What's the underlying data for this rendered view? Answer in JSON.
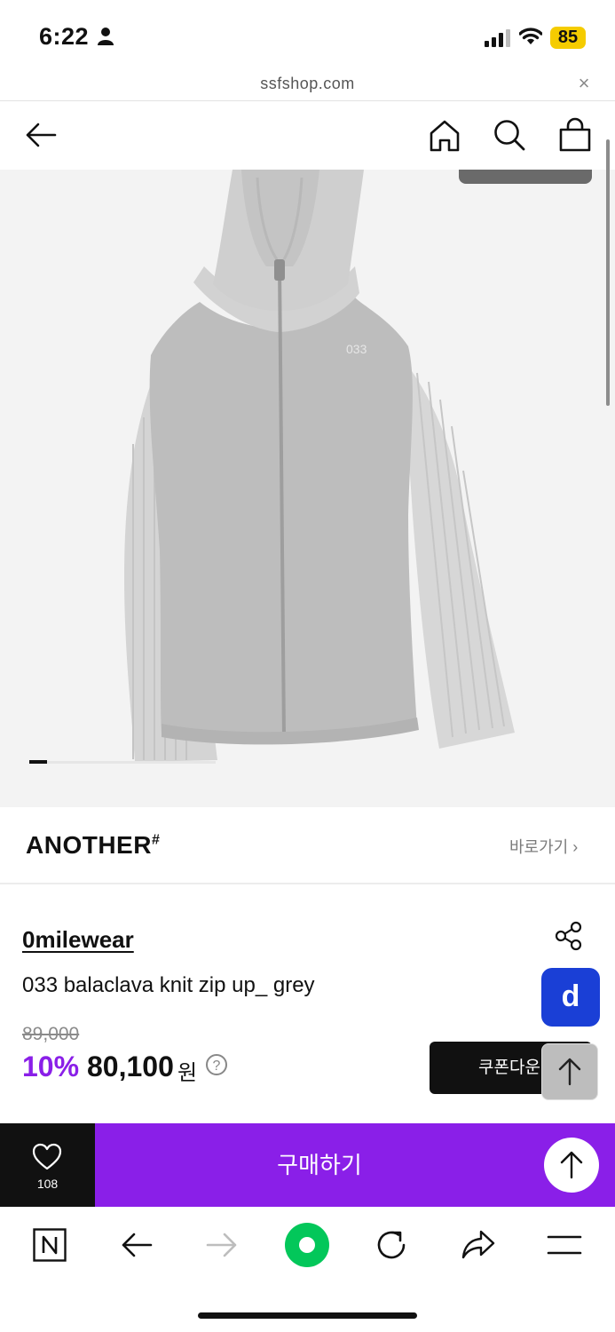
{
  "status_bar": {
    "time": "6:22",
    "battery": "85",
    "icons": [
      "person-icon",
      "signal-icon",
      "wifi-icon",
      "battery-icon"
    ]
  },
  "browser": {
    "url": "ssfshop.com",
    "close_glyph": "×"
  },
  "nav": {
    "icons": [
      "back-arrow-icon",
      "home-icon",
      "search-icon",
      "shopping-bag-icon"
    ]
  },
  "hero": {
    "embroidery": "033",
    "image_name": "grey-knit-zip-up-product-photo"
  },
  "brand": {
    "logo": "ANOTHER",
    "logo_mark": "#",
    "link_label": "바로가기 ›"
  },
  "product": {
    "seller": "0milewear",
    "name": "033 balaclava knit zip up_ grey",
    "original_price": "89,000",
    "discount": "10%",
    "price": "80,100",
    "currency": "원",
    "help": "?",
    "coupon_label": "쿠폰다운"
  },
  "floating": {
    "d_badge": "d",
    "icons": [
      "share-icon",
      "scroll-top-icon"
    ]
  },
  "purchase_bar": {
    "wish_count": "108",
    "buy_label": "구매하기"
  },
  "bottom_bar": {
    "icons": [
      "naver-icon",
      "back-icon",
      "forward-icon",
      "green-dot-icon",
      "reload-icon",
      "share-arrow-icon",
      "menu-icon"
    ]
  },
  "colors": {
    "accent_purple": "#8a1fe8",
    "d_badge_blue": "#1a3fd6",
    "battery_yellow": "#f5cc00",
    "naver_green": "#03c75a"
  }
}
